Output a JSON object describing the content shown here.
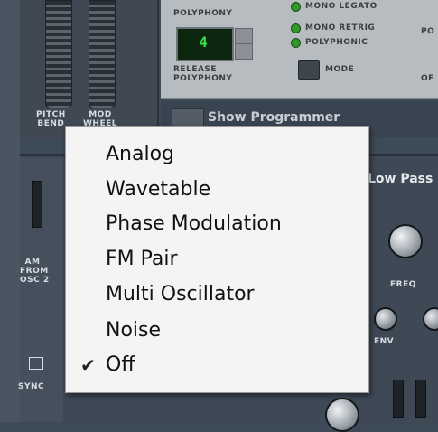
{
  "wheels": {
    "pitch_label": "PITCH\nBEND",
    "mod_label": "MOD\nWHEEL"
  },
  "polyphony": {
    "title": "POLYPHONY",
    "lcd_value": "4",
    "release_label": "RELEASE\nPOLYPHONY",
    "modes": [
      "MONO LEGATO",
      "MONO RETRIG",
      "POLYPHONIC"
    ],
    "mode_button_label": "MODE",
    "portamento_fragment_top": "PO",
    "portamento_fragment_bottom": "OF"
  },
  "programmer": {
    "button_label": "Show Programmer"
  },
  "filter": {
    "title": "Low Pass",
    "freq_label": "FREQ",
    "env_label": "ENV"
  },
  "amp": {
    "am_label": "AM\nFROM\nOSC 2",
    "sync_label": "SYNC"
  },
  "menu": {
    "items": [
      {
        "label": "Analog",
        "checked": false
      },
      {
        "label": "Wavetable",
        "checked": false
      },
      {
        "label": "Phase Modulation",
        "checked": false
      },
      {
        "label": "FM Pair",
        "checked": false
      },
      {
        "label": "Multi Oscillator",
        "checked": false
      },
      {
        "label": "Noise",
        "checked": false
      },
      {
        "label": "Off",
        "checked": true
      }
    ],
    "check_glyph": "✔"
  },
  "colors": {
    "lcd_green": "#38e04a",
    "led_green": "#2e9a2a"
  }
}
